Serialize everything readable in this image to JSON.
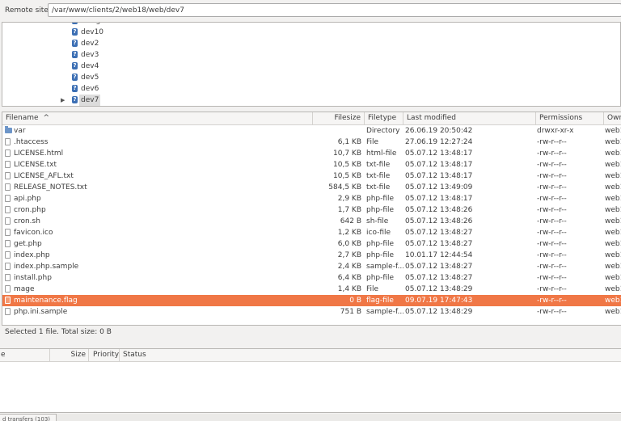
{
  "remote_site": {
    "label": "Remote site:",
    "path": "/var/www/clients/2/web18/web/dev7"
  },
  "tree": {
    "items": [
      {
        "label": "designer2"
      },
      {
        "label": "dev10"
      },
      {
        "label": "dev2"
      },
      {
        "label": "dev3"
      },
      {
        "label": "dev4"
      },
      {
        "label": "dev5"
      },
      {
        "label": "dev6"
      },
      {
        "label": "dev7",
        "selected": true
      }
    ]
  },
  "file_list": {
    "columns": {
      "filename": "Filename",
      "sort_indicator": "^",
      "filesize": "Filesize",
      "filetype": "Filetype",
      "last_modified": "Last modified",
      "permissions": "Permissions",
      "owner": "Own"
    },
    "rows": [
      {
        "name": "var",
        "size": "",
        "type": "Directory",
        "modified": "26.06.19 20:50:42",
        "perms": "drwxr-xr-x",
        "owner": "web1",
        "folder": true
      },
      {
        "name": ".htaccess",
        "size": "6,1 KB",
        "type": "File",
        "modified": "27.06.19 12:27:24",
        "perms": "-rw-r--r--",
        "owner": "web1"
      },
      {
        "name": "LICENSE.html",
        "size": "10,7 KB",
        "type": "html-file",
        "modified": "05.07.12 13:48:17",
        "perms": "-rw-r--r--",
        "owner": "web1"
      },
      {
        "name": "LICENSE.txt",
        "size": "10,5 KB",
        "type": "txt-file",
        "modified": "05.07.12 13:48:17",
        "perms": "-rw-r--r--",
        "owner": "web1"
      },
      {
        "name": "LICENSE_AFL.txt",
        "size": "10,5 KB",
        "type": "txt-file",
        "modified": "05.07.12 13:48:17",
        "perms": "-rw-r--r--",
        "owner": "web1"
      },
      {
        "name": "RELEASE_NOTES.txt",
        "size": "584,5 KB",
        "type": "txt-file",
        "modified": "05.07.12 13:49:09",
        "perms": "-rw-r--r--",
        "owner": "web1"
      },
      {
        "name": "api.php",
        "size": "2,9 KB",
        "type": "php-file",
        "modified": "05.07.12 13:48:17",
        "perms": "-rw-r--r--",
        "owner": "web1"
      },
      {
        "name": "cron.php",
        "size": "1,7 KB",
        "type": "php-file",
        "modified": "05.07.12 13:48:26",
        "perms": "-rw-r--r--",
        "owner": "web1"
      },
      {
        "name": "cron.sh",
        "size": "642 B",
        "type": "sh-file",
        "modified": "05.07.12 13:48:26",
        "perms": "-rw-r--r--",
        "owner": "web1"
      },
      {
        "name": "favicon.ico",
        "size": "1,2 KB",
        "type": "ico-file",
        "modified": "05.07.12 13:48:27",
        "perms": "-rw-r--r--",
        "owner": "web1"
      },
      {
        "name": "get.php",
        "size": "6,0 KB",
        "type": "php-file",
        "modified": "05.07.12 13:48:27",
        "perms": "-rw-r--r--",
        "owner": "web1"
      },
      {
        "name": "index.php",
        "size": "2,7 KB",
        "type": "php-file",
        "modified": "10.01.17 12:44:54",
        "perms": "-rw-r--r--",
        "owner": "web1"
      },
      {
        "name": "index.php.sample",
        "size": "2,4 KB",
        "type": "sample-f...",
        "modified": "05.07.12 13:48:27",
        "perms": "-rw-r--r--",
        "owner": "web1"
      },
      {
        "name": "install.php",
        "size": "6,4 KB",
        "type": "php-file",
        "modified": "05.07.12 13:48:27",
        "perms": "-rw-r--r--",
        "owner": "web1"
      },
      {
        "name": "mage",
        "size": "1,4 KB",
        "type": "File",
        "modified": "05.07.12 13:48:29",
        "perms": "-rw-r--r--",
        "owner": "web1"
      },
      {
        "name": "maintenance.flag",
        "size": "0 B",
        "type": "flag-file",
        "modified": "09.07.19 17:47:43",
        "perms": "-rw-r--r--",
        "owner": "web1",
        "selected": true
      },
      {
        "name": "php.ini.sample",
        "size": "751 B",
        "type": "sample-f...",
        "modified": "05.07.12 13:48:29",
        "perms": "-rw-r--r--",
        "owner": "web1"
      }
    ]
  },
  "status": {
    "text": "Selected 1 file. Total size: 0 B"
  },
  "queue": {
    "columns": {
      "file": "e",
      "size": "Size",
      "priority": "Priority",
      "status": "Status"
    }
  },
  "tabs": {
    "failed": "d transfers (103)"
  },
  "colors": {
    "selection": "#f07746",
    "folder": "#6d95c8",
    "unknown_icon": "#3c6fb4"
  }
}
